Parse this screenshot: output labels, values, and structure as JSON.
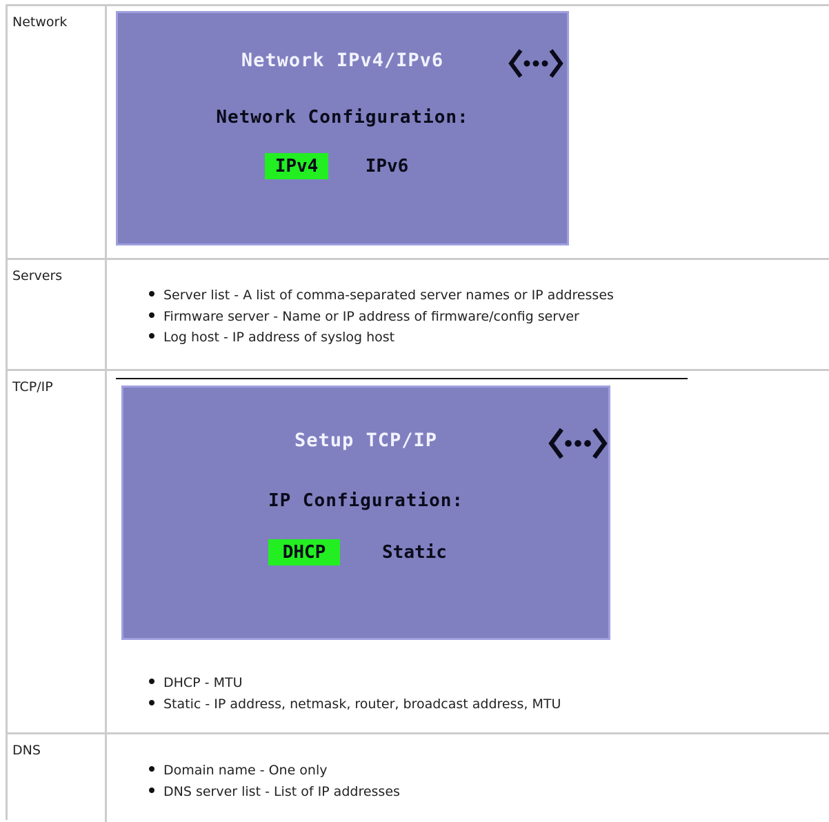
{
  "rows": [
    {
      "label": "Network",
      "screen": {
        "title": "Network IPv4/IPv6",
        "heading": "Network Configuration:",
        "options": [
          "IPv4",
          "IPv6"
        ],
        "selected": "IPv4",
        "icon": "nav-arrows-icon"
      }
    },
    {
      "label": "Servers",
      "bullets": [
        "Server list - A list of comma-separated server names or IP addresses",
        "Firmware server - Name or IP address of firmware/config server",
        "Log host - IP address of syslog host"
      ]
    },
    {
      "label": "TCP/IP",
      "screen": {
        "title": "Setup TCP/IP",
        "heading": "IP Configuration:",
        "options": [
          "DHCP",
          "Static"
        ],
        "selected": "DHCP",
        "icon": "nav-arrows-icon"
      },
      "bullets": [
        "DHCP - MTU",
        "Static - IP address, netmask, router, broadcast address, MTU"
      ]
    },
    {
      "label": "DNS",
      "bullets": [
        "Domain name - One only",
        "DNS server list - List of IP addresses"
      ]
    }
  ],
  "colors": {
    "screen_bg": "#8080c0",
    "screen_border": "#a0a0e0",
    "selected_option": "#22ee22",
    "table_border": "#cccccc"
  }
}
